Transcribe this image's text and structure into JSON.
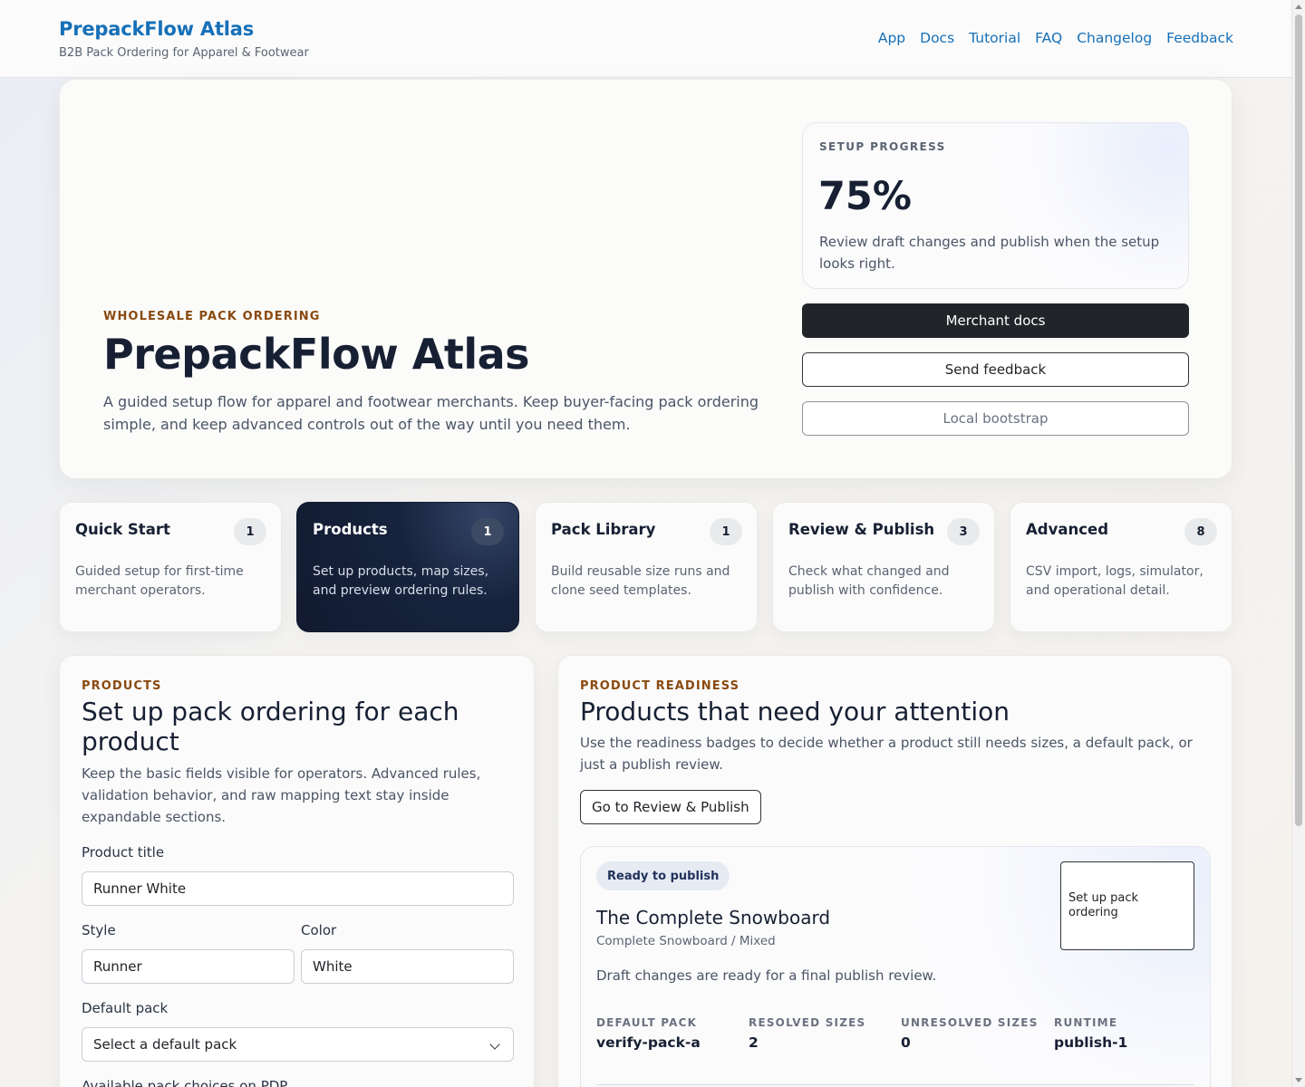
{
  "header": {
    "brand": "PrepackFlow Atlas",
    "subtitle": "B2B Pack Ordering for Apparel & Footwear",
    "nav": [
      "App",
      "Docs",
      "Tutorial",
      "FAQ",
      "Changelog",
      "Feedback"
    ]
  },
  "hero": {
    "eyebrow": "WHOLESALE PACK ORDERING",
    "title": "PrepackFlow Atlas",
    "description": "A guided setup flow for apparel and footwear merchants. Keep buyer-facing pack ordering simple, and keep advanced controls out of the way until you need them.",
    "progress": {
      "label": "SETUP PROGRESS",
      "value": "75%",
      "note": "Review draft changes and publish when the setup looks right."
    },
    "buttons": {
      "docs": "Merchant docs",
      "feedback": "Send feedback",
      "bootstrap": "Local bootstrap"
    }
  },
  "steps": [
    {
      "title": "Quick Start",
      "count": "1",
      "desc": "Guided setup for first-time merchant operators."
    },
    {
      "title": "Products",
      "count": "1",
      "desc": "Set up products, map sizes, and preview ordering rules."
    },
    {
      "title": "Pack Library",
      "count": "1",
      "desc": "Build reusable size runs and clone seed templates."
    },
    {
      "title": "Review & Publish",
      "count": "3",
      "desc": "Check what changed and publish with confidence."
    },
    {
      "title": "Advanced",
      "count": "8",
      "desc": "CSV import, logs, simulator, and operational detail."
    }
  ],
  "products": {
    "eyebrow": "PRODUCTS",
    "title": "Set up pack ordering for each product",
    "description": "Keep the basic fields visible for operators. Advanced rules, validation behavior, and raw mapping text stay inside expandable sections.",
    "fields": {
      "title_label": "Product title",
      "title_value": "Runner White",
      "style_label": "Style",
      "style_value": "Runner",
      "color_label": "Color",
      "color_value": "White",
      "pack_label": "Default pack",
      "pack_value": "Select a default pack",
      "choices_label": "Available pack choices on PDP"
    }
  },
  "readiness": {
    "eyebrow": "PRODUCT READINESS",
    "title": "Products that need your attention",
    "description": "Use the readiness badges to decide whether a product still needs sizes, a default pack, or just a publish review.",
    "button": "Go to Review & Publish",
    "card": {
      "status": "Ready to publish",
      "action": "Set up pack ordering",
      "name": "The Complete Snowboard",
      "meta": "Complete Snowboard / Mixed",
      "note": "Draft changes are ready for a final publish review.",
      "stats": [
        {
          "label": "DEFAULT PACK",
          "value": "verify-pack-a"
        },
        {
          "label": "RESOLVED SIZES",
          "value": "2"
        },
        {
          "label": "UNRESOLVED SIZES",
          "value": "0"
        },
        {
          "label": "RUNTIME",
          "value": "publish-1"
        }
      ]
    }
  },
  "colors": {
    "brand": "#1670b8",
    "accent_eyebrow": "#8a4a10",
    "dark": "#172033",
    "active_step": "#111a30"
  }
}
